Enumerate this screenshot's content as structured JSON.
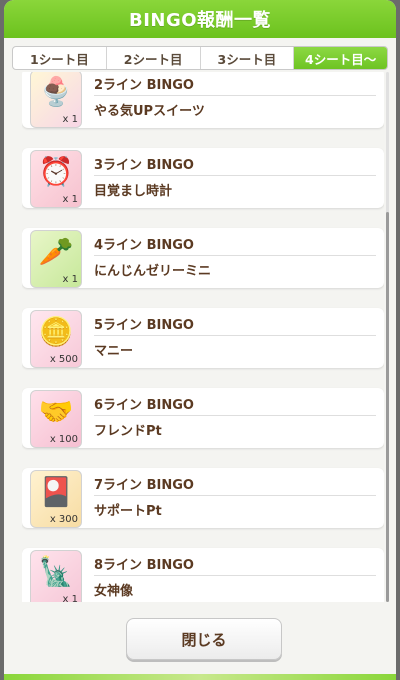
{
  "header": {
    "title": "BINGO報酬一覧"
  },
  "tabs": [
    {
      "label": "1シート目"
    },
    {
      "label": "2シート目"
    },
    {
      "label": "3シート目"
    },
    {
      "label": "4シート目〜"
    }
  ],
  "rewards": [
    {
      "title": "2ライン BINGO",
      "name": "やる気UPスイーツ",
      "qty": "x 1",
      "icon": "parfait-icon",
      "glyph": "🍨"
    },
    {
      "title": "3ライン BINGO",
      "name": "目覚まし時計",
      "qty": "x 1",
      "icon": "alarm-clock-icon",
      "glyph": "⏰"
    },
    {
      "title": "4ライン BINGO",
      "name": "にんじんゼリーミニ",
      "qty": "x 1",
      "icon": "carrot-jelly-icon",
      "glyph": "🥕"
    },
    {
      "title": "5ライン BINGO",
      "name": "マニー",
      "qty": "x 500",
      "icon": "money-coin-icon",
      "glyph": "🪙"
    },
    {
      "title": "6ライン BINGO",
      "name": "フレンドPt",
      "qty": "x 100",
      "icon": "friend-points-icon",
      "glyph": "🤝"
    },
    {
      "title": "7ライン BINGO",
      "name": "サポートPt",
      "qty": "x 300",
      "icon": "support-points-icon",
      "glyph": "🎴"
    },
    {
      "title": "8ライン BINGO",
      "name": "女神像",
      "qty": "x 1",
      "icon": "goddess-statue-icon",
      "glyph": "🗽"
    }
  ],
  "footer": {
    "close_label": "閉じる"
  }
}
